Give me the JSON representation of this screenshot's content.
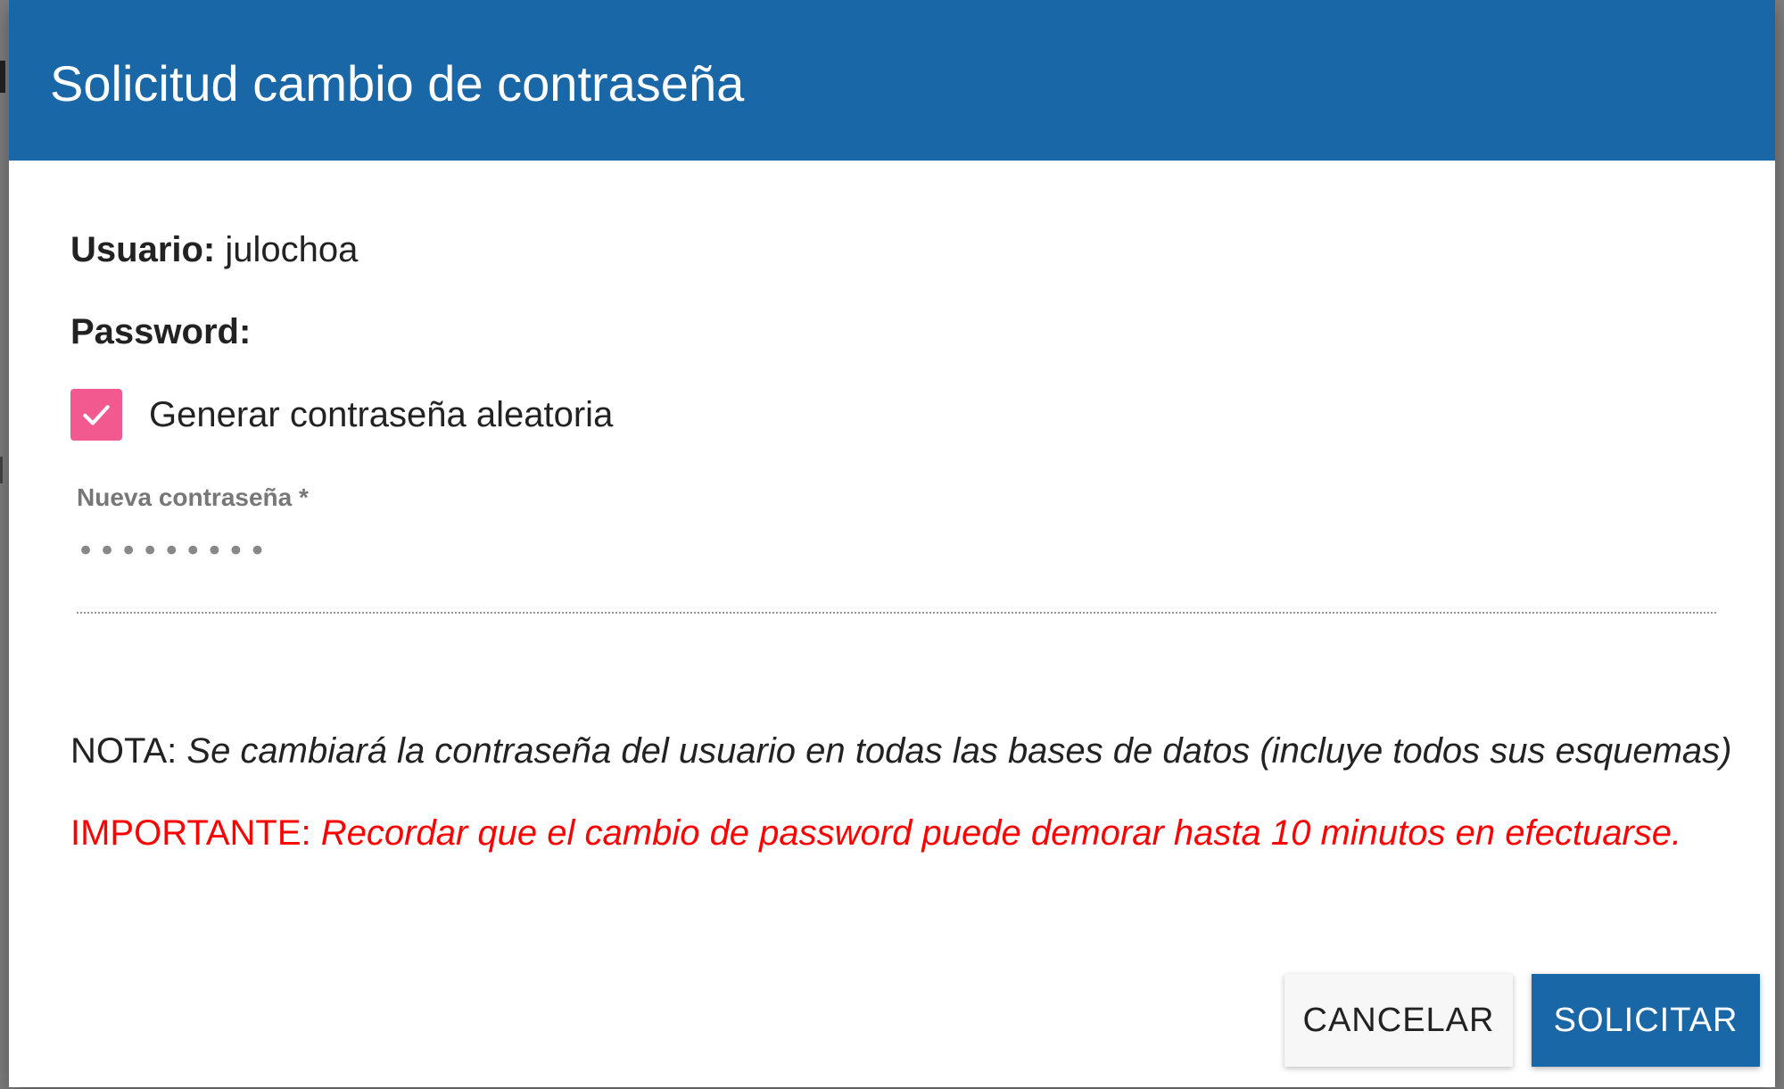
{
  "dialog": {
    "title": "Solicitud cambio de contraseña",
    "user_label": "Usuario:",
    "user_value": "julochoa",
    "password_label": "Password:",
    "random_checkbox": {
      "label": "Generar contraseña aleatoria",
      "checked": true
    },
    "new_password": {
      "label": "Nueva contraseña *",
      "value": "•••••••••"
    },
    "note": {
      "prefix": "NOTA:",
      "text": "Se cambiará la contraseña del usuario en todas las bases de datos (incluye todos sus esquemas)"
    },
    "important": {
      "prefix": "IMPORTANTE:",
      "text": "Recordar que el cambio de password puede demorar hasta 10 minutos en efectuarse."
    },
    "buttons": {
      "cancel": "CANCELAR",
      "submit": "SOLICITAR"
    }
  },
  "colors": {
    "header": "#1a67a8",
    "checkbox": "#f25a8f",
    "important": "#ff0000",
    "primary_button": "#1a67a8"
  },
  "icons": {
    "checkbox": "checkmark-icon"
  }
}
